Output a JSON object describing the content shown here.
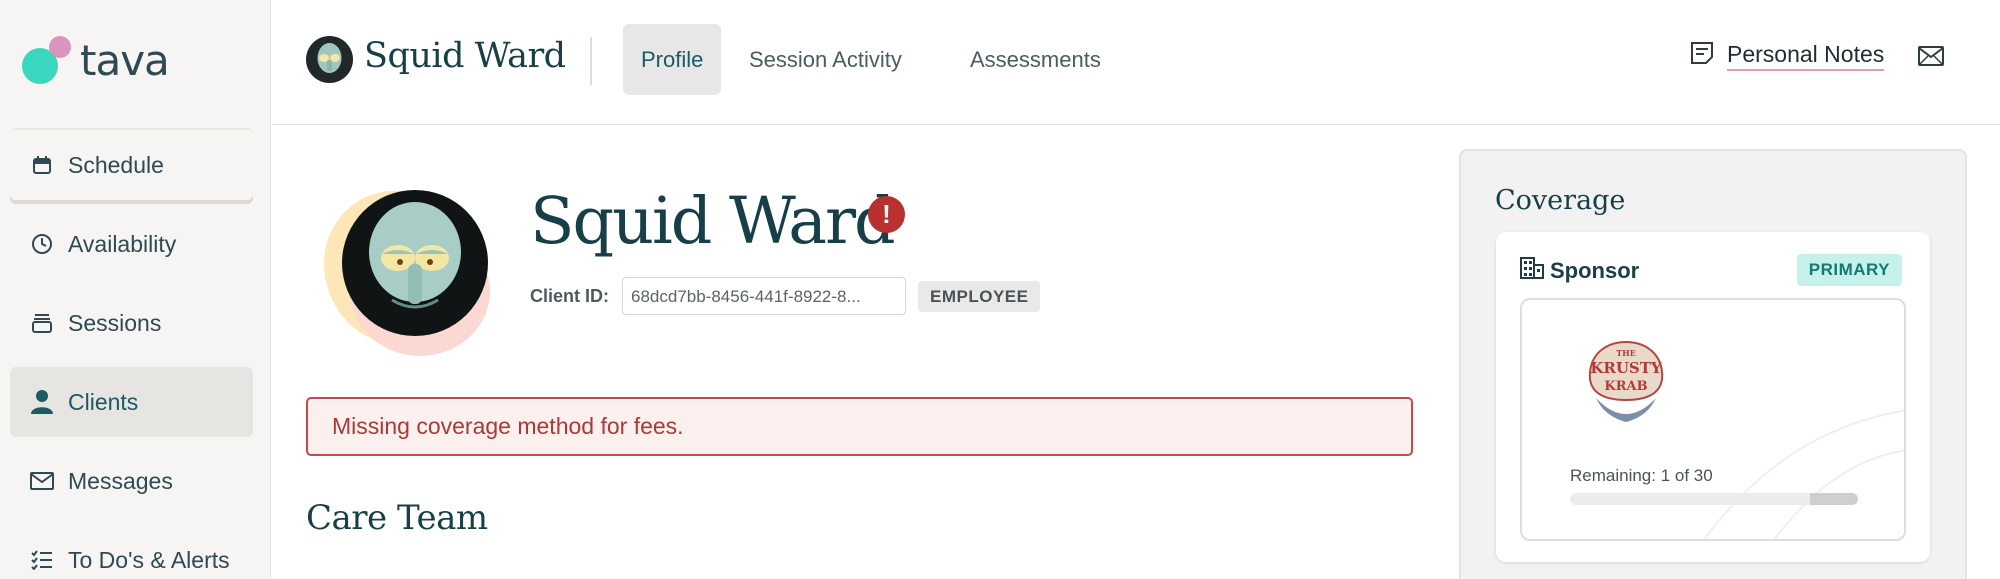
{
  "app": {
    "logo_text": "tava"
  },
  "sidebar": {
    "items": [
      {
        "label": "Schedule",
        "icon": "calendar-icon"
      },
      {
        "label": "Availability",
        "icon": "clock-icon"
      },
      {
        "label": "Sessions",
        "icon": "stack-icon"
      },
      {
        "label": "Clients",
        "icon": "person-icon",
        "active": true
      },
      {
        "label": "Messages",
        "icon": "envelope-icon"
      },
      {
        "label": "To Do's & Alerts",
        "icon": "checklist-icon"
      }
    ]
  },
  "header": {
    "client_name": "Squid Ward",
    "tabs": [
      {
        "label": "Profile",
        "active": true
      },
      {
        "label": "Session Activity"
      },
      {
        "label": "Assessments"
      }
    ],
    "personal_notes_label": "Personal Notes"
  },
  "profile": {
    "name": "Squid Ward",
    "client_id_label": "Client ID:",
    "client_id_value": "68dcd7bb-8456-441f-8922-8...",
    "type_badge": "EMPLOYEE",
    "warning": "Missing coverage method for fees.",
    "care_team_title": "Care Team"
  },
  "coverage": {
    "title": "Coverage",
    "sponsor_label": "Sponsor",
    "primary_badge": "PRIMARY",
    "sponsor_logo_text": [
      "THE",
      "KRUSTY",
      "KRAB"
    ],
    "remaining_text": "Remaining: 1 of 30",
    "remaining_fraction": 0.033
  },
  "colors": {
    "accent_teal": "#1d5a63",
    "alert_red": "#b8312f",
    "primary_badge_bg": "#c6f0ea"
  }
}
